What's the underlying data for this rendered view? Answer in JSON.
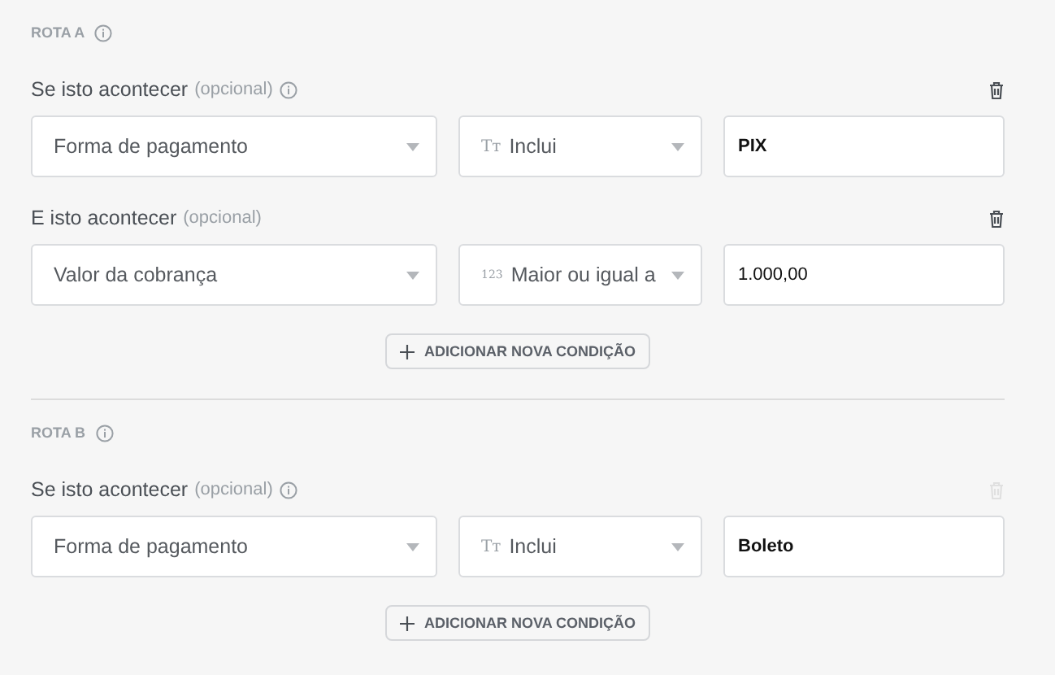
{
  "routes": [
    {
      "title": "ROTA A",
      "conditions": [
        {
          "label": "Se isto acontecer",
          "optional": "(opcional)",
          "info": true,
          "delete_disabled": false,
          "field": "Forma de pagamento",
          "operator_glyph": "Tт",
          "operator": "Inclui",
          "value": "PIX"
        },
        {
          "label": "E isto acontecer",
          "optional": "(opcional)",
          "info": false,
          "delete_disabled": false,
          "field": "Valor da cobrança",
          "operator_glyph": "123",
          "operator": "Maior ou igual a",
          "value": "1.000,00"
        }
      ],
      "add_button": "ADICIONAR NOVA CONDIÇÃO"
    },
    {
      "title": "ROTA B",
      "conditions": [
        {
          "label": "Se isto acontecer",
          "optional": "(opcional)",
          "info": true,
          "delete_disabled": true,
          "field": "Forma de pagamento",
          "operator_glyph": "Tт",
          "operator": "Inclui",
          "value": "Boleto"
        }
      ],
      "add_button": "ADICIONAR NOVA CONDIÇÃO"
    }
  ]
}
